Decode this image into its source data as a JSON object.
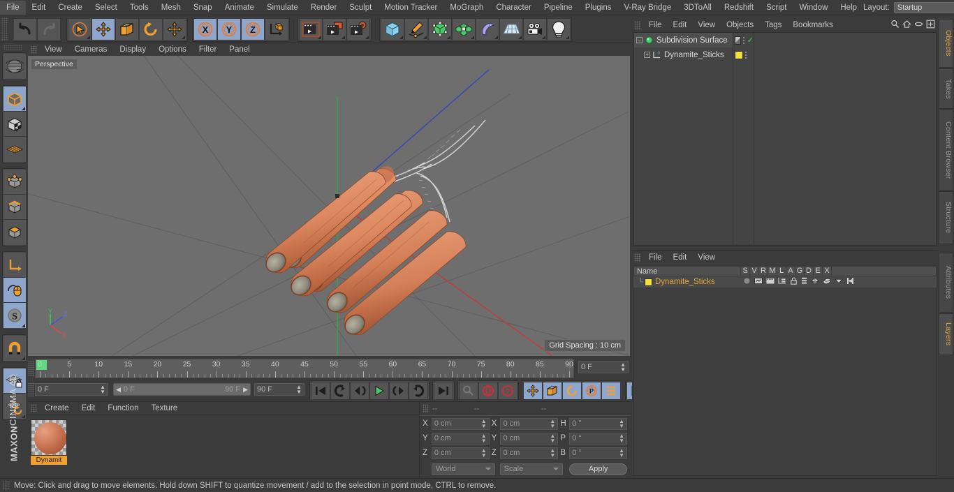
{
  "app": {
    "title": "MAXON CINEMA 4D",
    "brand_top": "MAXON",
    "brand_bottom": "CINEMA 4D"
  },
  "menubar": {
    "items": [
      {
        "label": "File"
      },
      {
        "label": "Edit"
      },
      {
        "label": "Create"
      },
      {
        "label": "Select"
      },
      {
        "label": "Tools"
      },
      {
        "label": "Mesh"
      },
      {
        "label": "Snap"
      },
      {
        "label": "Animate"
      },
      {
        "label": "Simulate"
      },
      {
        "label": "Render"
      },
      {
        "label": "Sculpt"
      },
      {
        "label": "Motion Tracker"
      },
      {
        "label": "MoGraph"
      },
      {
        "label": "Character"
      },
      {
        "label": "Pipeline"
      },
      {
        "label": "Plugins"
      },
      {
        "label": "V-Ray Bridge"
      },
      {
        "label": "3DToAll"
      },
      {
        "label": "Redshift"
      },
      {
        "label": "Script"
      },
      {
        "label": "Window"
      },
      {
        "label": "Help"
      }
    ],
    "layout_label": "Layout:",
    "layout_value": "Startup",
    "search_icon": "search-icon"
  },
  "toolbar": {
    "groups": [
      {
        "name": "history",
        "buttons": [
          {
            "name": "undo-button",
            "icon": "undo-icon",
            "selected": false
          },
          {
            "name": "redo-button",
            "icon": "redo-icon",
            "selected": false
          }
        ]
      },
      {
        "name": "transform",
        "buttons": [
          {
            "name": "live-selection-button",
            "icon": "cursor-circle-icon",
            "selected": false
          },
          {
            "name": "move-tool-button",
            "icon": "move-arrows-icon",
            "selected": true
          },
          {
            "name": "scale-tool-button",
            "icon": "scale-box-icon",
            "selected": false
          },
          {
            "name": "rotate-tool-button",
            "icon": "rotate-arc-icon",
            "selected": false
          },
          {
            "name": "move-duplicate-button",
            "icon": "move-arrows-icon",
            "selected": false
          }
        ]
      },
      {
        "name": "axis-locks",
        "buttons": [
          {
            "name": "lock-x-axis-button",
            "icon": "x-axis-icon",
            "selected": true,
            "label": "X"
          },
          {
            "name": "lock-y-axis-button",
            "icon": "y-axis-icon",
            "selected": true,
            "label": "Y"
          },
          {
            "name": "lock-z-axis-button",
            "icon": "z-axis-icon",
            "selected": true,
            "label": "Z"
          },
          {
            "name": "world-object-coordinates-button",
            "icon": "axis-cube-icon",
            "selected": false
          }
        ]
      },
      {
        "name": "render",
        "buttons": [
          {
            "name": "render-view-button",
            "icon": "clapperboard-frame-icon",
            "selected": false
          },
          {
            "name": "render-to-picture-viewer-button",
            "icon": "clapperboard-window-icon",
            "selected": false
          },
          {
            "name": "render-settings-button",
            "icon": "clapperboard-gear-icon",
            "selected": false
          }
        ]
      },
      {
        "name": "create",
        "buttons": [
          {
            "name": "add-cube-button",
            "icon": "cube-icon",
            "selected": false
          },
          {
            "name": "add-spline-button",
            "icon": "pen-spline-icon",
            "selected": false
          },
          {
            "name": "add-generator-button",
            "icon": "green-cube-generator-icon",
            "selected": false
          },
          {
            "name": "add-mograph-button",
            "icon": "cloner-icon",
            "selected": false
          },
          {
            "name": "add-deformer-button",
            "icon": "bend-deformer-icon",
            "selected": false
          },
          {
            "name": "add-scene-object-button",
            "icon": "floor-grid-icon",
            "selected": false
          },
          {
            "name": "add-camera-button",
            "icon": "camera-icon",
            "selected": false
          },
          {
            "name": "add-light-button",
            "icon": "light-bulb-icon",
            "selected": false
          }
        ]
      }
    ]
  },
  "left_palette": {
    "groups": [
      {
        "buttons": [
          {
            "name": "undo-view-button",
            "icon": "globe-wire-icon",
            "selected": false
          }
        ]
      },
      {
        "buttons": [
          {
            "name": "model-mode-button",
            "icon": "model-cube-icon",
            "selected": true
          },
          {
            "name": "texture-mode-button",
            "icon": "texture-cube-icon",
            "selected": false
          },
          {
            "name": "workplane-mode-button",
            "icon": "workplane-icon",
            "selected": false
          }
        ]
      },
      {
        "buttons": [
          {
            "name": "points-mode-button",
            "icon": "points-cube-icon",
            "selected": false
          },
          {
            "name": "edges-mode-button",
            "icon": "edges-cube-icon",
            "selected": false
          },
          {
            "name": "polygons-mode-button",
            "icon": "polygons-cube-icon",
            "selected": false
          }
        ]
      },
      {
        "buttons": [
          {
            "name": "object-axis-mode-button",
            "icon": "axis-l-icon",
            "selected": false
          },
          {
            "name": "enable-axis-modification-button",
            "icon": "mouse-axis-icon",
            "selected": true
          },
          {
            "name": "soft-selection-button",
            "icon": "s-sphere-icon",
            "selected": true
          }
        ]
      },
      {
        "buttons": [
          {
            "name": "enable-snap-button",
            "icon": "magnet-icon",
            "selected": false
          }
        ]
      },
      {
        "buttons": [
          {
            "name": "lock-workplane-button",
            "icon": "grid-lock-icon",
            "selected": true
          },
          {
            "name": "planar-workplane-button",
            "icon": "grid-rotate-icon",
            "selected": false
          }
        ]
      }
    ]
  },
  "viewport": {
    "menu": [
      {
        "label": "View"
      },
      {
        "label": "Cameras"
      },
      {
        "label": "Display"
      },
      {
        "label": "Options"
      },
      {
        "label": "Filter"
      },
      {
        "label": "Panel"
      }
    ],
    "label": "Perspective",
    "grid_spacing": "Grid Spacing : 10 cm",
    "axis_gizmo": {
      "x": "X",
      "y": "Y",
      "z": "Z"
    },
    "colors": {
      "background": "#6e6e6e",
      "axis_x": "#d04a4a",
      "axis_y": "#4ad04a",
      "axis_z": "#4a4ad0",
      "dynamite_light": "#e79a74",
      "dynamite_mid": "#d4784f",
      "dynamite_dark": "#b05c36"
    }
  },
  "timeline": {
    "ticks": [
      "0",
      "5",
      "10",
      "15",
      "20",
      "25",
      "30",
      "35",
      "40",
      "45",
      "50",
      "55",
      "60",
      "65",
      "70",
      "75",
      "80",
      "85",
      "90"
    ],
    "current_frame": "0 F",
    "range_start": "0 F",
    "range_end": "90 F",
    "max_frame": "90 F",
    "frame_field_right": "0 F",
    "transport": [
      {
        "name": "go-to-start-button",
        "icon": "skip-start-icon",
        "selected": false
      },
      {
        "name": "go-to-previous-key-button",
        "icon": "prev-key-icon",
        "selected": false
      },
      {
        "name": "step-back-button",
        "icon": "step-back-icon",
        "selected": false
      },
      {
        "name": "play-button",
        "icon": "play-icon",
        "selected": false
      },
      {
        "name": "step-forward-button",
        "icon": "step-forward-icon",
        "selected": false
      },
      {
        "name": "go-to-next-key-button",
        "icon": "next-key-icon",
        "selected": false
      },
      {
        "name": "go-to-end-button",
        "icon": "skip-end-icon",
        "selected": false
      }
    ],
    "record": [
      {
        "name": "autokeying-button",
        "icon": "key-icon",
        "selected": false
      },
      {
        "name": "record-active-objects-button",
        "icon": "record-circle-icon",
        "selected": false
      },
      {
        "name": "keyframe-selection-button",
        "icon": "question-circle-icon",
        "selected": false
      }
    ],
    "keytoggles": [
      {
        "name": "position-key-button",
        "icon": "move-arrows-icon",
        "selected": true
      },
      {
        "name": "scale-key-button",
        "icon": "scale-box-icon",
        "selected": true
      },
      {
        "name": "rotation-key-button",
        "icon": "rotate-arc-icon",
        "selected": true
      },
      {
        "name": "parameter-key-button",
        "icon": "p-circle-icon",
        "selected": true
      },
      {
        "name": "point-level-animation-button",
        "icon": "dots-grid-icon",
        "selected": true
      }
    ],
    "filmstrip": {
      "name": "animation-layers-button",
      "icon": "filmstrip-icon",
      "selected": true
    }
  },
  "material_manager": {
    "menu": [
      {
        "label": "Create"
      },
      {
        "label": "Edit"
      },
      {
        "label": "Function"
      },
      {
        "label": "Texture"
      }
    ],
    "materials": [
      {
        "name": "Dynamit",
        "swatch_color": "#d2805f"
      }
    ]
  },
  "coordinates": {
    "header_dashes": [
      "--",
      "--",
      "--"
    ],
    "rows": [
      {
        "l1": "X",
        "v1": "0 cm",
        "l2": "X",
        "v2": "0 cm",
        "l3": "H",
        "v3": "0 °"
      },
      {
        "l1": "Y",
        "v1": "0 cm",
        "l2": "Y",
        "v2": "0 cm",
        "l3": "P",
        "v3": "0 °"
      },
      {
        "l1": "Z",
        "v1": "0 cm",
        "l2": "Z",
        "v2": "0 cm",
        "l3": "B",
        "v3": "0 °"
      }
    ],
    "space_select": "World",
    "mode_select": "Scale",
    "apply_label": "Apply"
  },
  "object_manager": {
    "menu": [
      {
        "label": "File"
      },
      {
        "label": "Edit"
      },
      {
        "label": "View"
      },
      {
        "label": "Objects"
      },
      {
        "label": "Tags"
      },
      {
        "label": "Bookmarks"
      }
    ],
    "header_icons": [
      {
        "name": "search-icon"
      },
      {
        "name": "home-icon"
      },
      {
        "name": "ellipse-icon"
      },
      {
        "name": "add-layer-icon"
      }
    ],
    "rows": [
      {
        "name": "Subdivision Surface",
        "icon": "subdivision-surface-icon",
        "depth": 0,
        "expander": "-",
        "selected": true,
        "tags": [
          {
            "type": "phong-tag",
            "color": "#9a9a9a"
          }
        ],
        "check": true
      },
      {
        "name": "Dynamite_Sticks",
        "icon": "polygon-object-icon",
        "depth": 1,
        "expander": "+",
        "selected": false,
        "tags": [
          {
            "type": "material-tag",
            "color": "#f2e23a"
          }
        ],
        "check": false
      }
    ]
  },
  "layer_manager": {
    "menu": [
      {
        "label": "File"
      },
      {
        "label": "Edit"
      },
      {
        "label": "View"
      }
    ],
    "columns": [
      "Name",
      "S",
      "V",
      "R",
      "M",
      "L",
      "A",
      "G",
      "D",
      "E",
      "X"
    ],
    "rows": [
      {
        "name": "Dynamite_Sticks",
        "color": "#f2e23a",
        "icons": [
          "solo-dot-icon",
          "view-icon",
          "render-icon",
          "manager-icon",
          "lock-icon",
          "animation-icon",
          "generators-icon",
          "deformers-icon",
          "expressions-icon",
          "xref-icon"
        ]
      }
    ]
  },
  "side_tabs": {
    "top": [
      {
        "label": "Objects",
        "active": true
      },
      {
        "label": "Takes",
        "active": false
      },
      {
        "label": "Content Browser",
        "active": false
      },
      {
        "label": "Structure",
        "active": false
      }
    ],
    "bottom": [
      {
        "label": "Attributes",
        "active": false
      },
      {
        "label": "Layers",
        "active": true
      }
    ]
  },
  "statusbar": {
    "message": "Move: Click and drag to move elements. Hold down SHIFT to quantize movement / add to the selection in point mode, CTRL to remove."
  }
}
